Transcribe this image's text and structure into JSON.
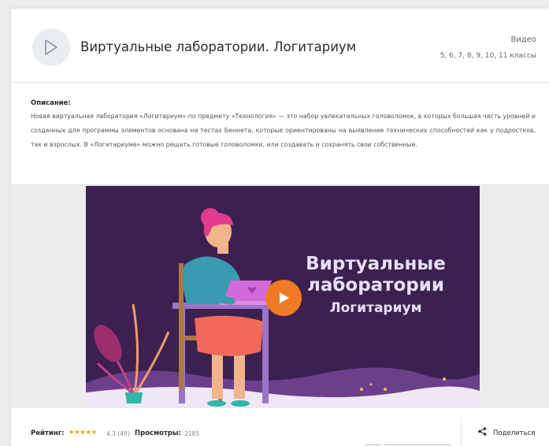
{
  "header": {
    "title": "Виртуальные лаборатории. Логитариум",
    "type_label": "Видео",
    "grades": "5, 6, 7, 8, 9, 10, 11 классы",
    "icon": "play-icon"
  },
  "description": {
    "heading": "Описание:",
    "text": "Новая виртуальная лаборатория «Логитариум» по предмету «Технология» — это набор увлекательных головоломок, в которых большая часть уровней и созданных для программы элементов основана на тестах Беннета, которые ориентированы на выявление технических способностей как у подростков, так и взрослых. В «Логитариуме» можно решать готовые головоломки, или создавать и сохранять свои собственные."
  },
  "video": {
    "title_line1": "Виртуальные",
    "title_line2": "лаборатории",
    "title_line3": "Логитариум",
    "play_icon": "play-icon",
    "accent_color": "#f07a23",
    "background_color": "#3c2150"
  },
  "footer": {
    "rating_label": "Рейтинг:",
    "stars": "★★★★★",
    "rating_value": "4.3 (49)",
    "views_label": "Просмотры:",
    "views_value": "2185",
    "share_label": "Поделиться",
    "share_icon": "share-icon"
  }
}
